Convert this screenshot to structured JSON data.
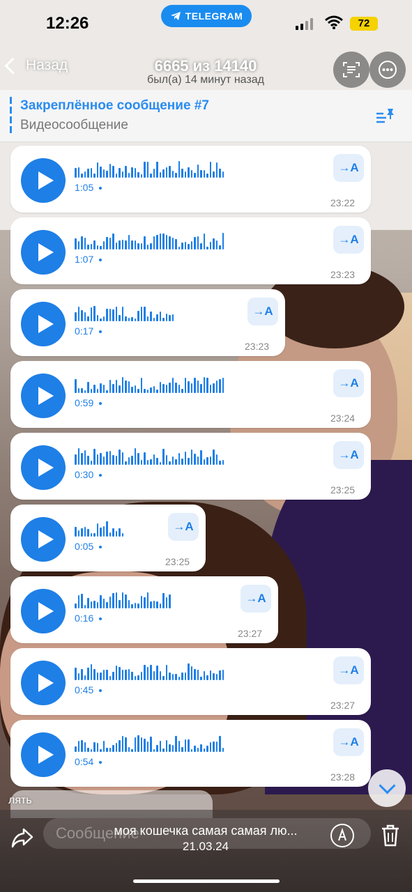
{
  "status": {
    "time": "12:26",
    "app_pill": "TELEGRAM",
    "battery": "72"
  },
  "header": {
    "back_label": "Назад",
    "counter": "6665 из 14140",
    "subtitle": "был(а) 14 минут назад"
  },
  "pinned": {
    "title": "Закреплённое сообщение #7",
    "text": "Видеосообщение"
  },
  "messages": [
    {
      "duration": "1:05",
      "time": "23:22"
    },
    {
      "duration": "1:07",
      "time": "23:23"
    },
    {
      "duration": "0:17",
      "time": "23:23"
    },
    {
      "duration": "0:59",
      "time": "23:24"
    },
    {
      "duration": "0:30",
      "time": "23:25"
    },
    {
      "duration": "0:05",
      "time": "23:25"
    },
    {
      "duration": "0:16",
      "time": "23:27"
    },
    {
      "duration": "0:45",
      "time": "23:27"
    },
    {
      "duration": "0:54",
      "time": "23:28"
    }
  ],
  "transcribe_label": "→A",
  "overlay_text": "лять",
  "footer": {
    "input_placeholder": "Сообщение",
    "caption": "моя кошечка самая самая лю...",
    "date": "21.03.24"
  },
  "colors": {
    "accent": "#1e7fe6",
    "pill": "#1a8cf0",
    "battery": "#f5d200"
  }
}
